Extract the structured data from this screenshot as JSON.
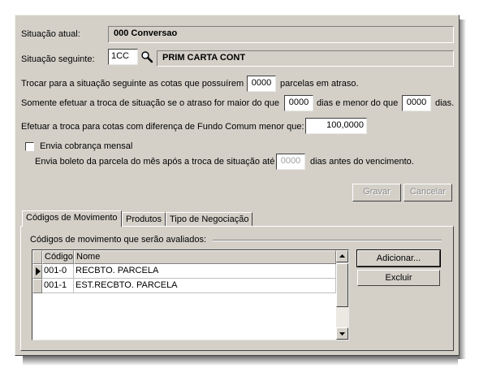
{
  "situacao_atual": {
    "label": "Situação atual:",
    "value": "000  Conversao"
  },
  "situacao_seguinte": {
    "label": "Situação seguinte:",
    "code": "1CC",
    "search_icon": "magnifier-icon",
    "description": "PRIM CARTA CONT"
  },
  "trocar": {
    "prefix": "Trocar para a situação seguinte as cotas que possuírem",
    "parcelas": "0000",
    "suffix": "parcelas em atraso."
  },
  "somente": {
    "prefix": "Somente efetuar a troca de situação se o atraso for maior do que",
    "maior_value": "0000",
    "middle": "dias e menor do que",
    "menor_value": "0000",
    "suffix": "dias."
  },
  "fundo_comum": {
    "label": "Efetuar a troca para cotas com diferença de Fundo Comum menor que:",
    "value": "100,0000"
  },
  "cobranca": {
    "checkbox_label": "Envia cobrança mensal",
    "checked": false,
    "boleto_prefix": "Envia boleto da parcela do mês após a troca de situação até",
    "boleto_value": "0000",
    "boleto_suffix": "dias antes do vencimento."
  },
  "actions": {
    "gravar": "Gravar",
    "cancelar": "Cancelar"
  },
  "tabs": [
    {
      "label": "Códigos de Movimento",
      "active": true
    },
    {
      "label": "Produtos",
      "active": false
    },
    {
      "label": "Tipo de Negociação",
      "active": false
    }
  ],
  "movimento": {
    "group_label": "Códigos de movimento que serão avaliados:",
    "columns": [
      "Código",
      "Nome"
    ],
    "rows": [
      {
        "codigo": "001-0",
        "nome": "RECBTO. PARCELA"
      },
      {
        "codigo": "001-1",
        "nome": "EST.RECBTO. PARCELA"
      }
    ],
    "adicionar": "Adicionar...",
    "excluir": "Excluir"
  },
  "colors": {
    "face": "#d4d0c8",
    "shadow": "#404040",
    "highlight": "#ffffff"
  }
}
